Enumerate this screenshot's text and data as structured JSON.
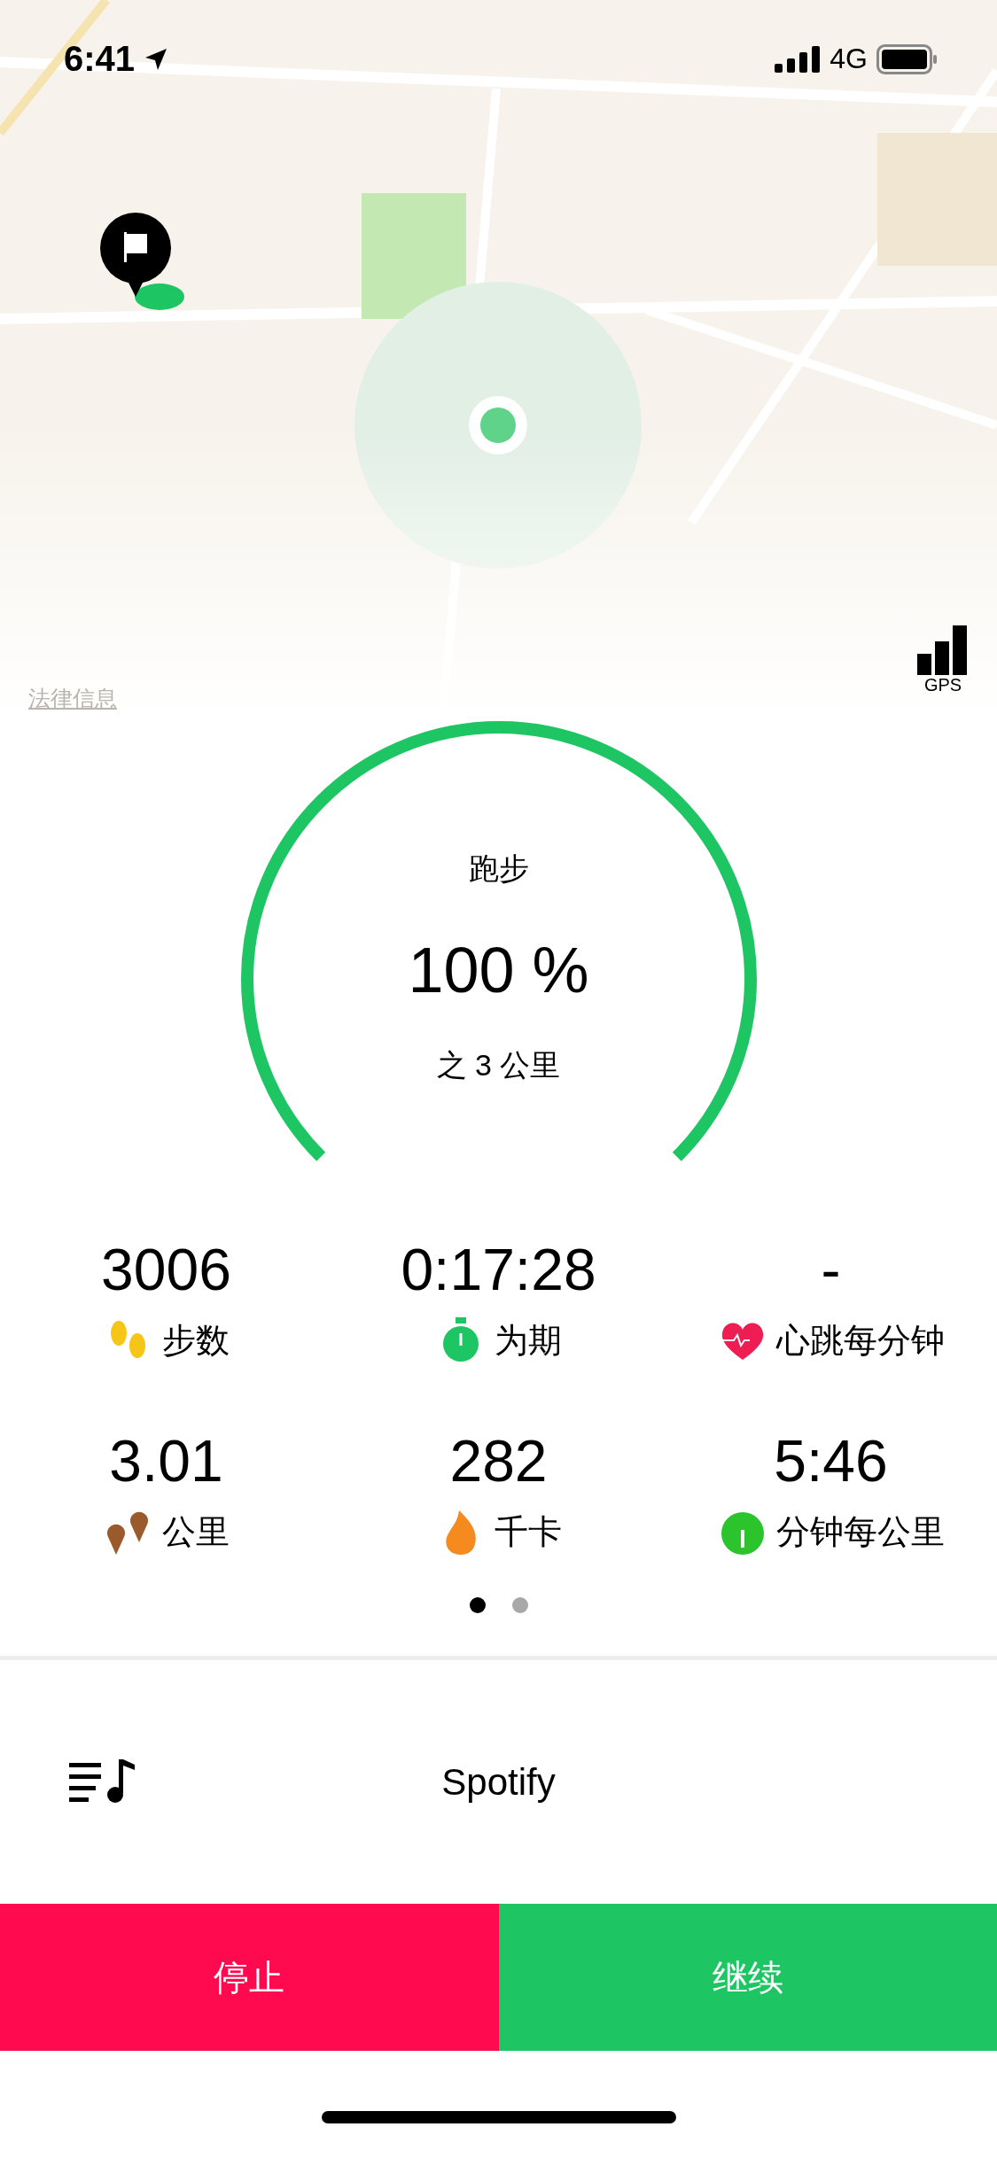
{
  "status_bar": {
    "time": "6:41",
    "network": "4G"
  },
  "map": {
    "legal_link": "法律信息",
    "gps_label": "GPS"
  },
  "goal": {
    "activity": "跑步",
    "percent": "100 %",
    "target": "之 3 公里",
    "level": 1
  },
  "stats": [
    {
      "value": "3006",
      "label": "步数",
      "kind": "steps"
    },
    {
      "value": "0:17:28",
      "label": "为期",
      "kind": "duration"
    },
    {
      "value": "-",
      "label": "心跳每分钟",
      "kind": "heartrate"
    },
    {
      "value": "3.01",
      "label": "公里",
      "kind": "distance"
    },
    {
      "value": "282",
      "label": "千卡",
      "kind": "calories"
    },
    {
      "value": "5:46",
      "label": "分钟每公里",
      "kind": "pace"
    }
  ],
  "pages": [
    {
      "selected": true
    },
    {
      "selected": false
    }
  ],
  "music": {
    "source": "Spotify"
  },
  "buttons": [
    {
      "label": "停止",
      "kind": "stop"
    },
    {
      "label": "继续",
      "kind": "resume"
    }
  ]
}
